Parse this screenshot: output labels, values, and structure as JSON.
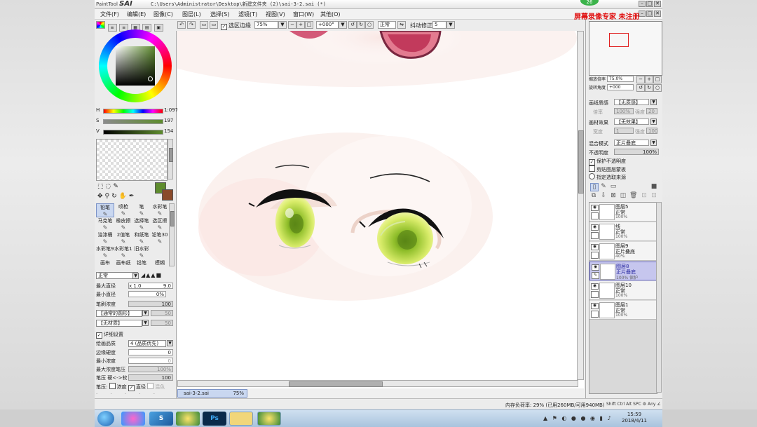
{
  "app": {
    "logo_small": "PaintTool",
    "logo_big": "SAI",
    "title_path": "C:\\Users\\Administrator\\Desktop\\新建文件夹 (2)\\sai-3-2.sai (*)",
    "badge": "26",
    "watermark": "屏幕录像专家  未注册"
  },
  "menu": [
    "文件(F)",
    "编辑(E)",
    "图像(C)",
    "图层(L)",
    "选择(S)",
    "滤镜(T)",
    "视图(V)",
    "窗口(W)",
    "其他(O)"
  ],
  "toolbar": {
    "selection_edge_label": "选区边缘",
    "zoom": "75%",
    "rotation": "+000°",
    "blend": "正常",
    "stabilizer_label": "抖动修正",
    "stabilizer_value": "5"
  },
  "color": {
    "current_hex": "#5e8c2e",
    "secondary_hex": "#8a4a2a",
    "h_label": "H",
    "h_value": "1:097",
    "s_label": "S",
    "s_value": "197",
    "v_label": "V",
    "v_value": "154"
  },
  "brushes": [
    {
      "label": "铅笔",
      "icon": "pencil-icon",
      "selected": true
    },
    {
      "label": "喷枪",
      "icon": "airbrush-icon",
      "selected": false
    },
    {
      "label": "笔",
      "icon": "pen-icon",
      "selected": false
    },
    {
      "label": "水彩笔",
      "icon": "watercolor-icon",
      "selected": false
    },
    {
      "label": "马克笔",
      "icon": "marker-icon",
      "selected": false
    },
    {
      "label": "橡皮擦",
      "icon": "eraser-icon",
      "selected": false
    },
    {
      "label": "选择笔",
      "icon": "select-pen-icon",
      "selected": false
    },
    {
      "label": "选区擦",
      "icon": "select-eraser-icon",
      "selected": false
    },
    {
      "label": "油漆桶",
      "icon": "bucket-icon",
      "selected": false
    },
    {
      "label": "2值笔",
      "icon": "binary-pen-icon",
      "selected": false
    },
    {
      "label": "和纸笔",
      "icon": "washi-pen-icon",
      "selected": false
    },
    {
      "label": "铅笔30",
      "icon": "pencil30-icon",
      "selected": false
    },
    {
      "label": "水彩笔9喷",
      "icon": "watercolor9-icon",
      "selected": false
    },
    {
      "label": "水彩笔10喷",
      "icon": "watercolor10-icon",
      "selected": false
    },
    {
      "label": "旧水彩",
      "icon": "old-watercolor-icon",
      "selected": false
    },
    {
      "label": "",
      "icon": "",
      "selected": false
    },
    {
      "label": "画布",
      "icon": "",
      "selected": false
    },
    {
      "label": "画布纸",
      "icon": "",
      "selected": false
    },
    {
      "label": "铅笔",
      "icon": "",
      "selected": false
    },
    {
      "label": "模糊",
      "icon": "",
      "selected": false
    }
  ],
  "brush_props": {
    "blend": "正常",
    "max_size_label": "最大直径",
    "max_size_mult": "x 1.0",
    "max_size_value": "9.0",
    "min_size_label": "最小直径",
    "min_size_value": "0%",
    "density_label": "笔刷浓度",
    "density_value": "100",
    "shape": "【通常的圆形】",
    "shape_value": "50",
    "texture": "【无材质】",
    "texture_value": "50",
    "detail_label": "详细设置",
    "quality_label": "绘画品质",
    "quality_value": "4 (品质优先)",
    "edge_label": "边缘硬度",
    "edge_value": "0",
    "min_density_label": "最小浓度",
    "min_density_value": "0",
    "max_pressure_label": "最大浓度笔压",
    "max_pressure_value": "100%",
    "pressure_label": "笔压 硬<->软",
    "pressure_value": "100",
    "pressure_opts_label": "笔压:",
    "pressure_density": "浓度",
    "pressure_size": "直径",
    "pressure_blend": "混色"
  },
  "right": {
    "zoom_label": "缩放倍率",
    "zoom_value": "75.0%",
    "rotate_label": "旋转角度",
    "rotate_value": "+000",
    "paper_label": "画纸质感",
    "paper_value": "【无质感】",
    "paper_scale_label": "倍率",
    "paper_scale_value": "100%",
    "paper_strength_label": "强度",
    "paper_strength_value": "20",
    "effect_label": "画材效果",
    "effect_value": "【无效果】",
    "effect_width_label": "宽度",
    "effect_width_value": "1",
    "effect_strength_label": "强度",
    "effect_strength_value": "100",
    "blend_label": "混合模式",
    "blend_value": "正片叠底",
    "opacity_label": "不透明度",
    "opacity_value": "100%",
    "protect_label": "保护不透明度",
    "clip_label": "剪贴图层蒙板",
    "source_label": "指定选取来源"
  },
  "layers": [
    {
      "name": "图层5",
      "mode": "正常",
      "opacity": "100%",
      "selected": false
    },
    {
      "name": "线",
      "mode": "正常",
      "opacity": "100%",
      "selected": false
    },
    {
      "name": "图层9",
      "mode": "正片叠底",
      "opacity": "40%",
      "selected": false
    },
    {
      "name": "图层8",
      "mode": "正片叠底",
      "opacity": "100% 保护",
      "selected": true
    },
    {
      "name": "图层10",
      "mode": "正常",
      "opacity": "100%",
      "selected": false
    },
    {
      "name": "图层1",
      "mode": "正常",
      "opacity": "100%",
      "selected": false
    }
  ],
  "document": {
    "tab_name": "sai-3-2.sai",
    "tab_zoom": "75%"
  },
  "status": {
    "memory": "内存负荷率: 29% (已用260MB/可用940MB)",
    "keys": "Shift Ctrl Alt SPC ⚙ Any ∠"
  },
  "taskbar": {
    "ps_label": "Ps",
    "time": "15:59",
    "date": "2018/4/11"
  }
}
